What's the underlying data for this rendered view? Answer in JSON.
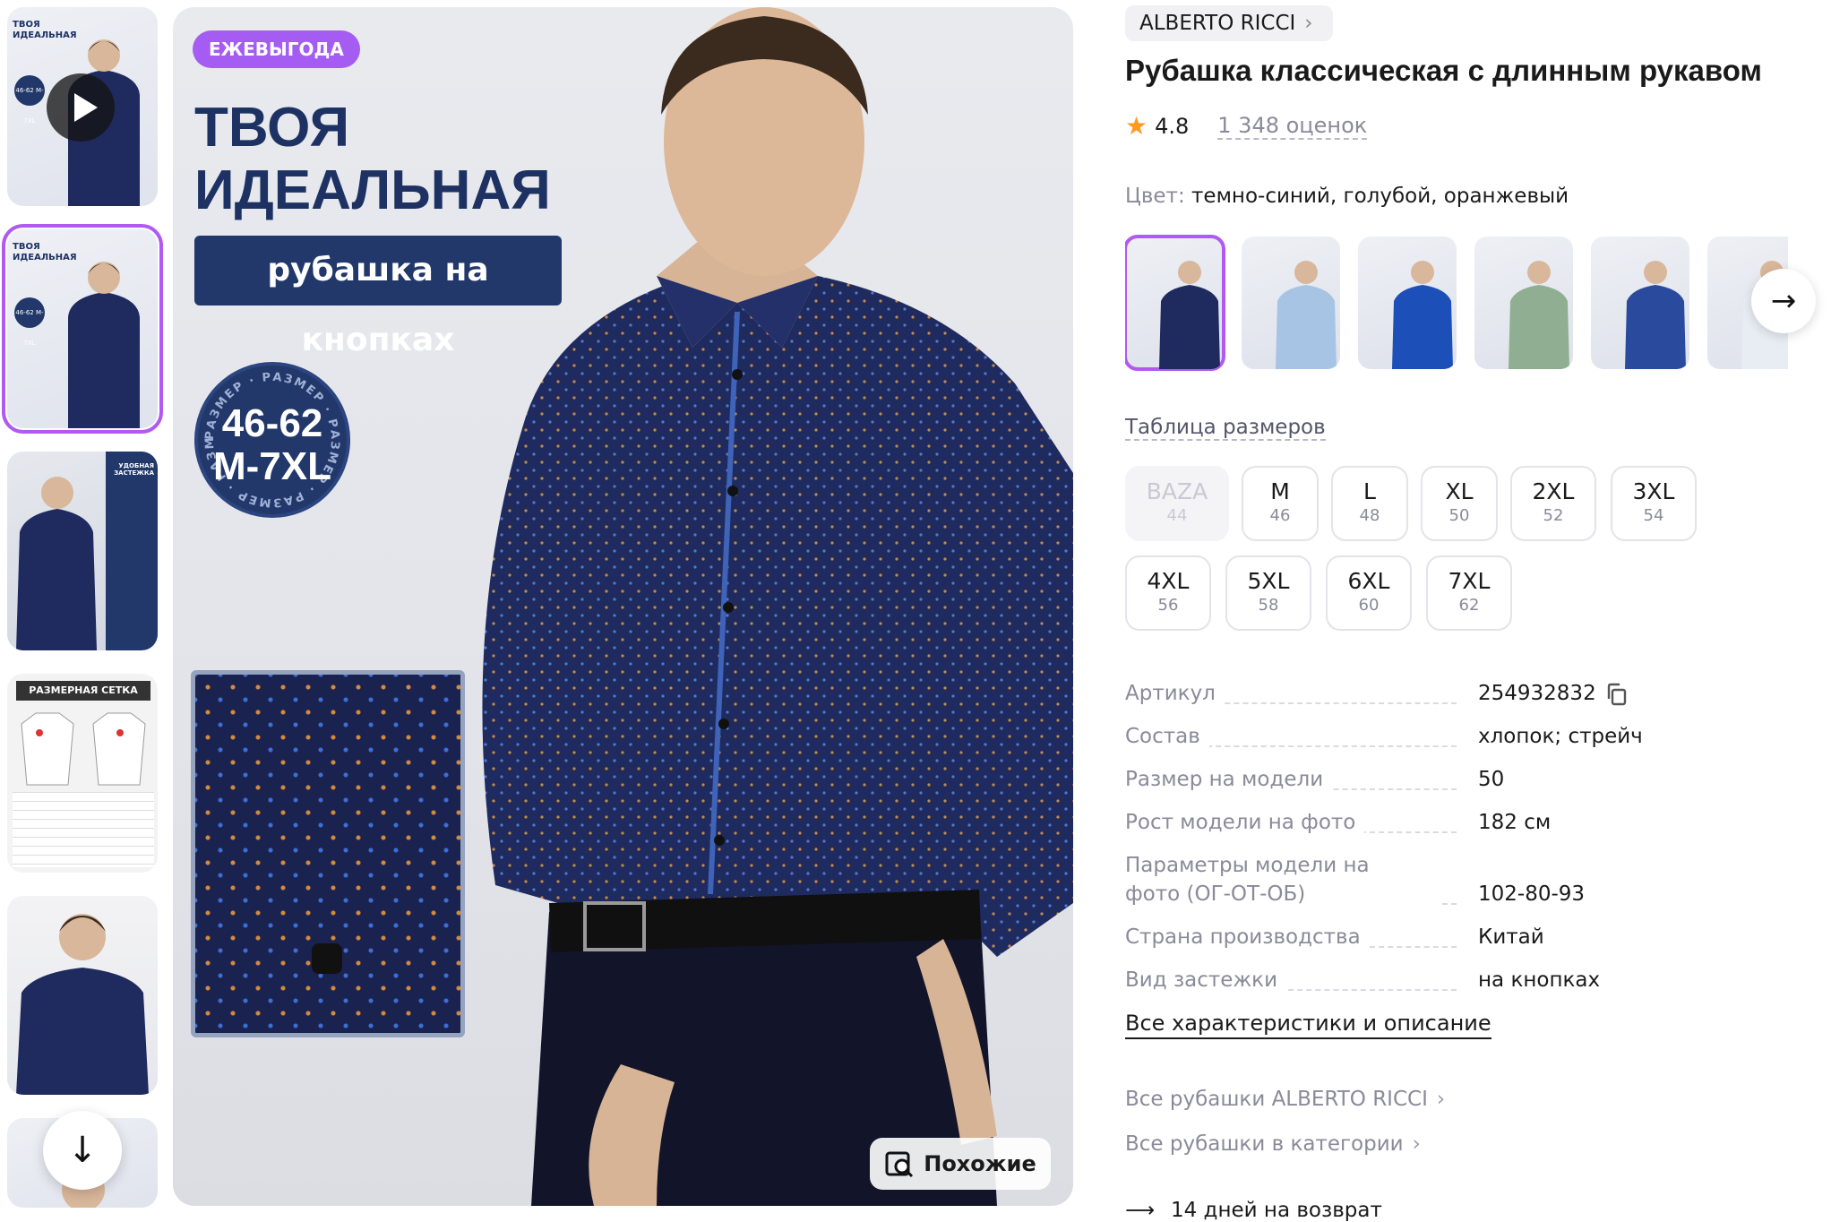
{
  "gallery": {
    "thumb_title": "ТВОЯ ИДЕАЛЬНАЯ",
    "thumb_subtitle": "рубашка на кнопках",
    "thumb_badge": "46-62 M-7XL",
    "thumb3_text": "УДОБНАЯ ЗАСТЕЖКА",
    "size_grid_title": "РАЗМЕРНАЯ СЕТКА",
    "down_icon": "arrow-down-icon",
    "play_icon": "play-icon"
  },
  "hero": {
    "badge": "ЕЖЕВЫГОДА",
    "title_line1": "ТВОЯ",
    "title_line2": "ИДЕАЛЬНАЯ",
    "subtitle": "рубашка на кнопках",
    "size_ring_text": "РАЗМЕР",
    "size_range": "46-62",
    "size_letters": "M-7XL",
    "similar_button": "Похожие"
  },
  "product": {
    "brand": "ALBERTO RICCI",
    "title": "Рубашка классическая с длинным рукавом",
    "rating": "4.8",
    "reviews": "1 348 оценок",
    "color_label": "Цвет:",
    "color_value": "темно-синий, голубой, оранжевый",
    "size_table_link": "Таблица размеров",
    "sizes": [
      {
        "label": "BAZA",
        "ru": "44",
        "available": false
      },
      {
        "label": "M",
        "ru": "46",
        "available": true
      },
      {
        "label": "L",
        "ru": "48",
        "available": true
      },
      {
        "label": "XL",
        "ru": "50",
        "available": true
      },
      {
        "label": "2XL",
        "ru": "52",
        "available": true
      },
      {
        "label": "3XL",
        "ru": "54",
        "available": true
      },
      {
        "label": "4XL",
        "ru": "56",
        "available": true
      },
      {
        "label": "5XL",
        "ru": "58",
        "available": true
      },
      {
        "label": "6XL",
        "ru": "60",
        "available": true
      },
      {
        "label": "7XL",
        "ru": "62",
        "available": true
      }
    ],
    "specs": [
      {
        "key": "Артикул",
        "value": "254932832"
      },
      {
        "key": "Состав",
        "value": "хлопок; стрейч"
      },
      {
        "key": "Размер на модели",
        "value": "50"
      },
      {
        "key": "Рост модели на фото",
        "value": "182 см"
      },
      {
        "key": "Параметры модели на фото (ОГ-ОТ-ОБ)",
        "value": "102-80-93"
      },
      {
        "key": "Страна производства",
        "value": "Китай"
      },
      {
        "key": "Вид застежки",
        "value": "на кнопках"
      }
    ],
    "all_specs_link": "Все характеристики и описание",
    "brand_link": "Все рубашки ALBERTO RICCI",
    "category_link": "Все рубашки в категории",
    "return_text": "14 дней на возврат"
  },
  "colors": {
    "shirt_navy": "#1f2b5e",
    "shirt_light": "#a8c4e4",
    "shirt_blue": "#1d4fb8",
    "shirt_green": "#8fae92",
    "shirt_royal": "#2a4a9e",
    "shirt_white": "#e8ecf3",
    "accent": "#b159f2",
    "star": "#ff9a1f"
  }
}
